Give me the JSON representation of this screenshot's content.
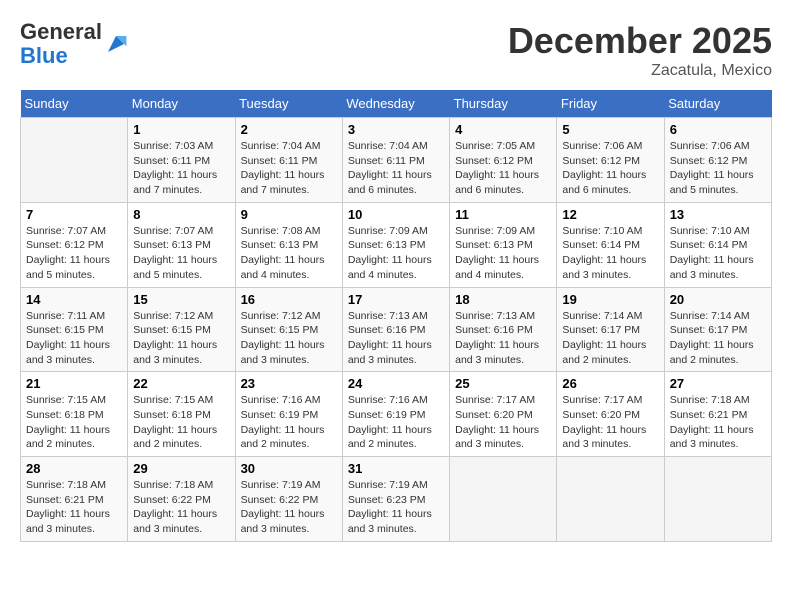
{
  "header": {
    "logo_general": "General",
    "logo_blue": "Blue",
    "month_title": "December 2025",
    "location": "Zacatula, Mexico"
  },
  "days_of_week": [
    "Sunday",
    "Monday",
    "Tuesday",
    "Wednesday",
    "Thursday",
    "Friday",
    "Saturday"
  ],
  "weeks": [
    [
      {
        "num": "",
        "info": ""
      },
      {
        "num": "1",
        "info": "Sunrise: 7:03 AM\nSunset: 6:11 PM\nDaylight: 11 hours\nand 7 minutes."
      },
      {
        "num": "2",
        "info": "Sunrise: 7:04 AM\nSunset: 6:11 PM\nDaylight: 11 hours\nand 7 minutes."
      },
      {
        "num": "3",
        "info": "Sunrise: 7:04 AM\nSunset: 6:11 PM\nDaylight: 11 hours\nand 6 minutes."
      },
      {
        "num": "4",
        "info": "Sunrise: 7:05 AM\nSunset: 6:12 PM\nDaylight: 11 hours\nand 6 minutes."
      },
      {
        "num": "5",
        "info": "Sunrise: 7:06 AM\nSunset: 6:12 PM\nDaylight: 11 hours\nand 6 minutes."
      },
      {
        "num": "6",
        "info": "Sunrise: 7:06 AM\nSunset: 6:12 PM\nDaylight: 11 hours\nand 5 minutes."
      }
    ],
    [
      {
        "num": "7",
        "info": "Sunrise: 7:07 AM\nSunset: 6:12 PM\nDaylight: 11 hours\nand 5 minutes."
      },
      {
        "num": "8",
        "info": "Sunrise: 7:07 AM\nSunset: 6:13 PM\nDaylight: 11 hours\nand 5 minutes."
      },
      {
        "num": "9",
        "info": "Sunrise: 7:08 AM\nSunset: 6:13 PM\nDaylight: 11 hours\nand 4 minutes."
      },
      {
        "num": "10",
        "info": "Sunrise: 7:09 AM\nSunset: 6:13 PM\nDaylight: 11 hours\nand 4 minutes."
      },
      {
        "num": "11",
        "info": "Sunrise: 7:09 AM\nSunset: 6:13 PM\nDaylight: 11 hours\nand 4 minutes."
      },
      {
        "num": "12",
        "info": "Sunrise: 7:10 AM\nSunset: 6:14 PM\nDaylight: 11 hours\nand 3 minutes."
      },
      {
        "num": "13",
        "info": "Sunrise: 7:10 AM\nSunset: 6:14 PM\nDaylight: 11 hours\nand 3 minutes."
      }
    ],
    [
      {
        "num": "14",
        "info": "Sunrise: 7:11 AM\nSunset: 6:15 PM\nDaylight: 11 hours\nand 3 minutes."
      },
      {
        "num": "15",
        "info": "Sunrise: 7:12 AM\nSunset: 6:15 PM\nDaylight: 11 hours\nand 3 minutes."
      },
      {
        "num": "16",
        "info": "Sunrise: 7:12 AM\nSunset: 6:15 PM\nDaylight: 11 hours\nand 3 minutes."
      },
      {
        "num": "17",
        "info": "Sunrise: 7:13 AM\nSunset: 6:16 PM\nDaylight: 11 hours\nand 3 minutes."
      },
      {
        "num": "18",
        "info": "Sunrise: 7:13 AM\nSunset: 6:16 PM\nDaylight: 11 hours\nand 3 minutes."
      },
      {
        "num": "19",
        "info": "Sunrise: 7:14 AM\nSunset: 6:17 PM\nDaylight: 11 hours\nand 2 minutes."
      },
      {
        "num": "20",
        "info": "Sunrise: 7:14 AM\nSunset: 6:17 PM\nDaylight: 11 hours\nand 2 minutes."
      }
    ],
    [
      {
        "num": "21",
        "info": "Sunrise: 7:15 AM\nSunset: 6:18 PM\nDaylight: 11 hours\nand 2 minutes."
      },
      {
        "num": "22",
        "info": "Sunrise: 7:15 AM\nSunset: 6:18 PM\nDaylight: 11 hours\nand 2 minutes."
      },
      {
        "num": "23",
        "info": "Sunrise: 7:16 AM\nSunset: 6:19 PM\nDaylight: 11 hours\nand 2 minutes."
      },
      {
        "num": "24",
        "info": "Sunrise: 7:16 AM\nSunset: 6:19 PM\nDaylight: 11 hours\nand 2 minutes."
      },
      {
        "num": "25",
        "info": "Sunrise: 7:17 AM\nSunset: 6:20 PM\nDaylight: 11 hours\nand 3 minutes."
      },
      {
        "num": "26",
        "info": "Sunrise: 7:17 AM\nSunset: 6:20 PM\nDaylight: 11 hours\nand 3 minutes."
      },
      {
        "num": "27",
        "info": "Sunrise: 7:18 AM\nSunset: 6:21 PM\nDaylight: 11 hours\nand 3 minutes."
      }
    ],
    [
      {
        "num": "28",
        "info": "Sunrise: 7:18 AM\nSunset: 6:21 PM\nDaylight: 11 hours\nand 3 minutes."
      },
      {
        "num": "29",
        "info": "Sunrise: 7:18 AM\nSunset: 6:22 PM\nDaylight: 11 hours\nand 3 minutes."
      },
      {
        "num": "30",
        "info": "Sunrise: 7:19 AM\nSunset: 6:22 PM\nDaylight: 11 hours\nand 3 minutes."
      },
      {
        "num": "31",
        "info": "Sunrise: 7:19 AM\nSunset: 6:23 PM\nDaylight: 11 hours\nand 3 minutes."
      },
      {
        "num": "",
        "info": ""
      },
      {
        "num": "",
        "info": ""
      },
      {
        "num": "",
        "info": ""
      }
    ]
  ]
}
